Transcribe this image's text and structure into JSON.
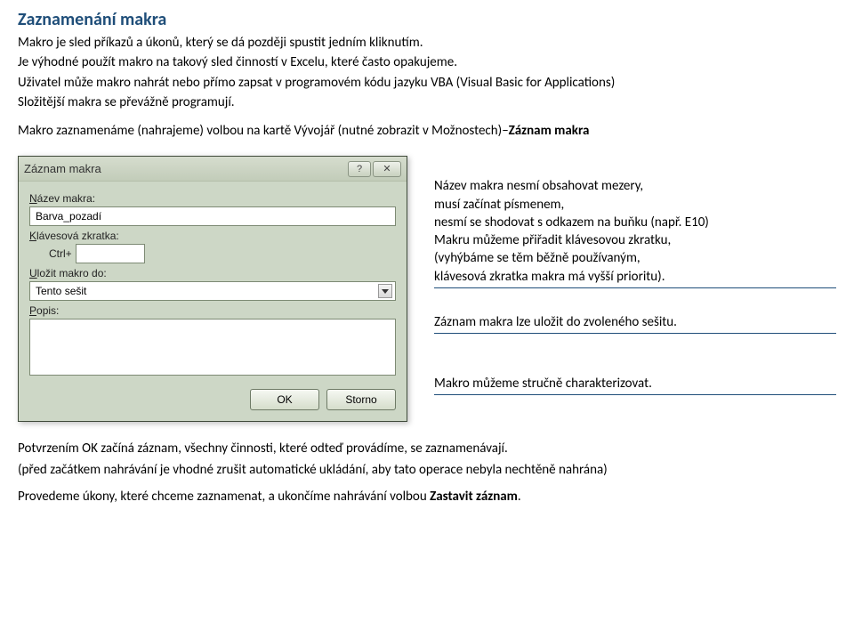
{
  "title": "Zaznamenání makra",
  "p1": "Makro je sled příkazů a úkonů, který se dá později spustit jedním kliknutím.",
  "p2": "Je výhodné použít makro na takový sled činností v Excelu, které často opakujeme.",
  "p3": "Uživatel může makro nahrát nebo přímo zapsat v programovém kódu jazyku VBA (Visual Basic for Applications)",
  "p4": "Složitější makra se převážně programují.",
  "p5a": "Makro zaznamenáme (nahrajeme) volbou na kartě Vývojář (nutné zobrazit v Možnostech)–",
  "p5b": "Záznam makra",
  "dialog": {
    "title": "Záznam makra",
    "help_icon": "?",
    "close_icon": "✕",
    "label_name_pre": "N",
    "label_name_rest": "ázev makra:",
    "name_value": "Barva_pozadí",
    "label_shortcut_pre": "K",
    "label_shortcut_rest": "lávesová zkratka:",
    "shortcut_prefix": "Ctrl+",
    "label_store_pre": "U",
    "label_store_rest": "ložit makro do:",
    "store_value": "Tento sešit",
    "label_desc_pre": "P",
    "label_desc_rest": "opis:",
    "btn_ok": "OK",
    "btn_cancel": "Storno"
  },
  "notes": {
    "n1": "Název makra nesmí obsahovat mezery,\nmusí začínat písmenem,\nnesmí se shodovat s odkazem na buňku (např. E10)\nMakru můžeme přiřadit klávesovou zkratku,\n(vyhýbáme se těm běžně používaným,\nklávesová zkratka makra má vyšší prioritu).",
    "n2": "Záznam makra lze uložit do zvoleného sešitu.",
    "n3": "Makro můžeme stručně charakterizovat."
  },
  "f1": "Potvrzením OK začíná záznam, všechny činnosti, které odteď provádíme, se zaznamenávají.",
  "f2": "(před začátkem nahrávání je vhodné zrušit automatické ukládání, aby tato operace nebyla nechtěně nahrána)",
  "f3a": "Provedeme úkony, které chceme zaznamenat, a ukončíme nahrávání volbou ",
  "f3b": "Zastavit záznam"
}
